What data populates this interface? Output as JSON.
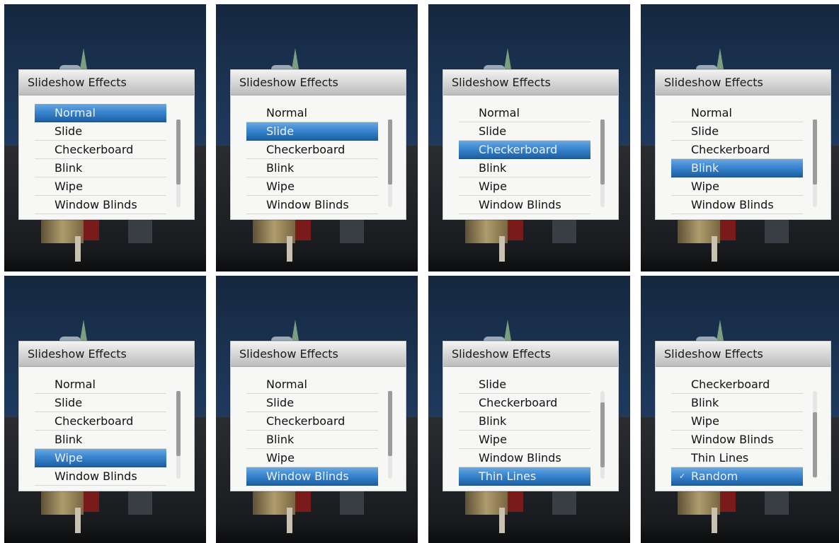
{
  "dialog_title": "Slideshow Effects",
  "colors": {
    "selection": "#2f7bc6",
    "dialog_bg": "#f7f7f5",
    "title_bar": "#d0d0d0",
    "scrollbar_thumb": "#9a9a9a"
  },
  "icons": {
    "check": "✓"
  },
  "panels": [
    {
      "items": [
        "Normal",
        "Slide",
        "Checkerboard",
        "Blink",
        "Wipe",
        "Window Blinds"
      ],
      "selected_index": 0
    },
    {
      "items": [
        "Normal",
        "Slide",
        "Checkerboard",
        "Blink",
        "Wipe",
        "Window Blinds"
      ],
      "selected_index": 1
    },
    {
      "items": [
        "Normal",
        "Slide",
        "Checkerboard",
        "Blink",
        "Wipe",
        "Window Blinds"
      ],
      "selected_index": 2
    },
    {
      "items": [
        "Normal",
        "Slide",
        "Checkerboard",
        "Blink",
        "Wipe",
        "Window Blinds"
      ],
      "selected_index": 3
    },
    {
      "items": [
        "Normal",
        "Slide",
        "Checkerboard",
        "Blink",
        "Wipe",
        "Window Blinds"
      ],
      "selected_index": 4
    },
    {
      "items": [
        "Normal",
        "Slide",
        "Checkerboard",
        "Blink",
        "Wipe",
        "Window Blinds"
      ],
      "selected_index": 5
    },
    {
      "items": [
        "Slide",
        "Checkerboard",
        "Blink",
        "Wipe",
        "Window Blinds",
        "Thin Lines"
      ],
      "selected_index": 5
    },
    {
      "items": [
        "Checkerboard",
        "Blink",
        "Wipe",
        "Window Blinds",
        "Thin Lines",
        "Random"
      ],
      "selected_index": 5,
      "checked_index": 5
    }
  ]
}
